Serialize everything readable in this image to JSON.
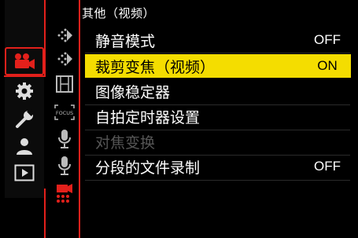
{
  "page": {
    "title": "其他（视频）"
  },
  "main_categories": [
    {
      "icon": "video-camera-icon",
      "active": true
    },
    {
      "icon": "gear-icon",
      "active": false
    },
    {
      "icon": "wrench-icon",
      "active": false
    },
    {
      "icon": "person-icon",
      "active": false
    },
    {
      "icon": "playback-icon",
      "active": false
    }
  ],
  "sub_tabs": [
    {
      "icon": "dotted-arrow-icon"
    },
    {
      "icon": "dotted-arrow-icon"
    },
    {
      "icon": "film-strip-icon"
    },
    {
      "icon": "focus-frame-icon",
      "text": "FOCUS"
    },
    {
      "icon": "microphone-icon"
    },
    {
      "icon": "microphone-icon"
    },
    {
      "icon": "red-camera-icon",
      "active": true
    }
  ],
  "menu": {
    "items": [
      {
        "label": "静音模式",
        "value": "OFF",
        "state": "normal"
      },
      {
        "label": "裁剪变焦（视频）",
        "value": "ON",
        "state": "selected"
      },
      {
        "label": "图像稳定器",
        "value": "",
        "state": "normal"
      },
      {
        "label": "自拍定时器设置",
        "value": "",
        "state": "normal"
      },
      {
        "label": "对焦变换",
        "value": "",
        "state": "disabled"
      },
      {
        "label": "分段的文件录制",
        "value": "OFF",
        "state": "normal"
      }
    ]
  },
  "colors": {
    "accent_red": "#e3201b",
    "highlight_yellow": "#f4dd00",
    "background": "#000000",
    "disabled_text": "#555555"
  }
}
